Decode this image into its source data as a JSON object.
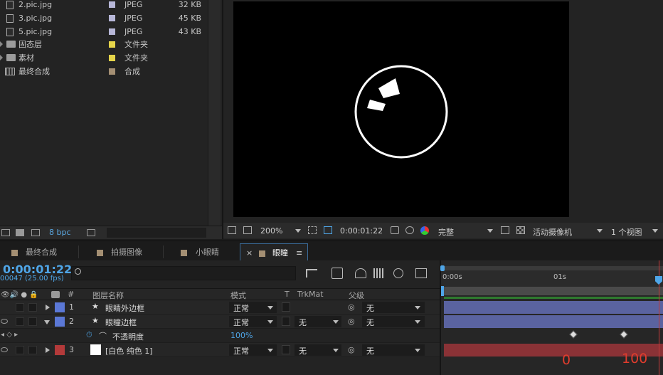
{
  "project": {
    "items": [
      {
        "name": "2.pic.jpg",
        "type": "JPEG",
        "size": "32 KB",
        "kind": "file",
        "label_color": "#b7b7d8"
      },
      {
        "name": "3.pic.jpg",
        "type": "JPEG",
        "size": "45 KB",
        "kind": "file",
        "label_color": "#b7b7d8"
      },
      {
        "name": "5.pic.jpg",
        "type": "JPEG",
        "size": "43 KB",
        "kind": "file",
        "label_color": "#b7b7d8"
      },
      {
        "name": "固态层",
        "type": "文件夹",
        "size": "",
        "kind": "folder",
        "label_color": "#e6d54a"
      },
      {
        "name": "素材",
        "type": "文件夹",
        "size": "",
        "kind": "folder",
        "label_color": "#e6d54a"
      },
      {
        "name": "最终合成",
        "type": "合成",
        "size": "",
        "kind": "comp",
        "label_color": "#a48f73"
      }
    ],
    "footer": {
      "bpc": "8 bpc"
    }
  },
  "viewer": {
    "zoom": "200%",
    "timecode": "0:00:01:22",
    "resolution": "完整",
    "camera": "活动摄像机",
    "views": "1 个视图"
  },
  "tabs": [
    {
      "label": "最终合成",
      "active": false
    },
    {
      "label": "拍摄图像",
      "active": false
    },
    {
      "label": "小眼睛",
      "active": false
    },
    {
      "label": "眼瞳",
      "active": true
    }
  ],
  "timeline": {
    "timecode": "0:00:01:22",
    "frames": "00047 (25.00 fps)",
    "headers": {
      "num": "#",
      "name": "图层名称",
      "mode": "模式",
      "t": "T",
      "trkmat": "TrkMat",
      "parent": "父级"
    },
    "layers": [
      {
        "num": "1",
        "name": "眼睛外边框",
        "mode": "正常",
        "trkmat": "",
        "parent": "无",
        "label_color": "#5b78d6",
        "expanded": false
      },
      {
        "num": "2",
        "name": "眼瞳边框",
        "mode": "正常",
        "trkmat": "无",
        "parent": "无",
        "label_color": "#5b78d6",
        "expanded": true
      },
      {
        "num": "3",
        "name": "[白色 纯色 1]",
        "mode": "正常",
        "trkmat": "无",
        "parent": "无",
        "label_color": "#b33a3a",
        "expanded": false
      }
    ],
    "property": {
      "name": "不透明度",
      "value": "100%"
    },
    "ruler": {
      "t0": "0:00s",
      "t1": "01s"
    },
    "annotations": {
      "a": "0",
      "b": "100"
    }
  },
  "colors": {
    "accent": "#4fa6e8",
    "layer_bar_blue": "#5a63a0",
    "layer_bar_red": "#8a3236",
    "annotation": "#e03c2d"
  }
}
